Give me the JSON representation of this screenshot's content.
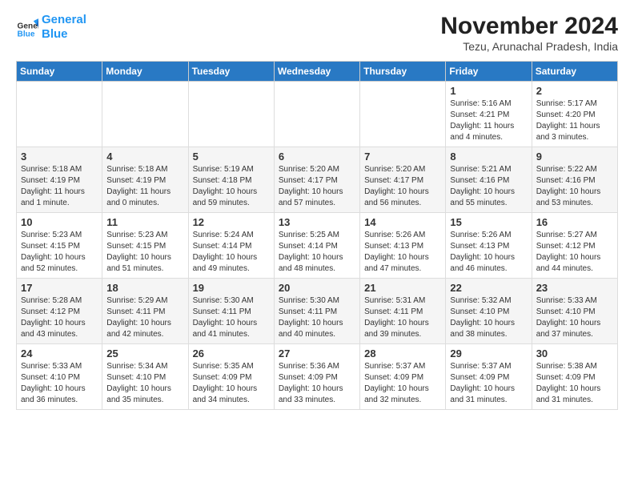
{
  "header": {
    "logo_line1": "General",
    "logo_line2": "Blue",
    "month_title": "November 2024",
    "subtitle": "Tezu, Arunachal Pradesh, India"
  },
  "weekdays": [
    "Sunday",
    "Monday",
    "Tuesday",
    "Wednesday",
    "Thursday",
    "Friday",
    "Saturday"
  ],
  "weeks": [
    [
      {
        "day": "",
        "info": ""
      },
      {
        "day": "",
        "info": ""
      },
      {
        "day": "",
        "info": ""
      },
      {
        "day": "",
        "info": ""
      },
      {
        "day": "",
        "info": ""
      },
      {
        "day": "1",
        "info": "Sunrise: 5:16 AM\nSunset: 4:21 PM\nDaylight: 11 hours\nand 4 minutes."
      },
      {
        "day": "2",
        "info": "Sunrise: 5:17 AM\nSunset: 4:20 PM\nDaylight: 11 hours\nand 3 minutes."
      }
    ],
    [
      {
        "day": "3",
        "info": "Sunrise: 5:18 AM\nSunset: 4:19 PM\nDaylight: 11 hours\nand 1 minute."
      },
      {
        "day": "4",
        "info": "Sunrise: 5:18 AM\nSunset: 4:19 PM\nDaylight: 11 hours\nand 0 minutes."
      },
      {
        "day": "5",
        "info": "Sunrise: 5:19 AM\nSunset: 4:18 PM\nDaylight: 10 hours\nand 59 minutes."
      },
      {
        "day": "6",
        "info": "Sunrise: 5:20 AM\nSunset: 4:17 PM\nDaylight: 10 hours\nand 57 minutes."
      },
      {
        "day": "7",
        "info": "Sunrise: 5:20 AM\nSunset: 4:17 PM\nDaylight: 10 hours\nand 56 minutes."
      },
      {
        "day": "8",
        "info": "Sunrise: 5:21 AM\nSunset: 4:16 PM\nDaylight: 10 hours\nand 55 minutes."
      },
      {
        "day": "9",
        "info": "Sunrise: 5:22 AM\nSunset: 4:16 PM\nDaylight: 10 hours\nand 53 minutes."
      }
    ],
    [
      {
        "day": "10",
        "info": "Sunrise: 5:23 AM\nSunset: 4:15 PM\nDaylight: 10 hours\nand 52 minutes."
      },
      {
        "day": "11",
        "info": "Sunrise: 5:23 AM\nSunset: 4:15 PM\nDaylight: 10 hours\nand 51 minutes."
      },
      {
        "day": "12",
        "info": "Sunrise: 5:24 AM\nSunset: 4:14 PM\nDaylight: 10 hours\nand 49 minutes."
      },
      {
        "day": "13",
        "info": "Sunrise: 5:25 AM\nSunset: 4:14 PM\nDaylight: 10 hours\nand 48 minutes."
      },
      {
        "day": "14",
        "info": "Sunrise: 5:26 AM\nSunset: 4:13 PM\nDaylight: 10 hours\nand 47 minutes."
      },
      {
        "day": "15",
        "info": "Sunrise: 5:26 AM\nSunset: 4:13 PM\nDaylight: 10 hours\nand 46 minutes."
      },
      {
        "day": "16",
        "info": "Sunrise: 5:27 AM\nSunset: 4:12 PM\nDaylight: 10 hours\nand 44 minutes."
      }
    ],
    [
      {
        "day": "17",
        "info": "Sunrise: 5:28 AM\nSunset: 4:12 PM\nDaylight: 10 hours\nand 43 minutes."
      },
      {
        "day": "18",
        "info": "Sunrise: 5:29 AM\nSunset: 4:11 PM\nDaylight: 10 hours\nand 42 minutes."
      },
      {
        "day": "19",
        "info": "Sunrise: 5:30 AM\nSunset: 4:11 PM\nDaylight: 10 hours\nand 41 minutes."
      },
      {
        "day": "20",
        "info": "Sunrise: 5:30 AM\nSunset: 4:11 PM\nDaylight: 10 hours\nand 40 minutes."
      },
      {
        "day": "21",
        "info": "Sunrise: 5:31 AM\nSunset: 4:11 PM\nDaylight: 10 hours\nand 39 minutes."
      },
      {
        "day": "22",
        "info": "Sunrise: 5:32 AM\nSunset: 4:10 PM\nDaylight: 10 hours\nand 38 minutes."
      },
      {
        "day": "23",
        "info": "Sunrise: 5:33 AM\nSunset: 4:10 PM\nDaylight: 10 hours\nand 37 minutes."
      }
    ],
    [
      {
        "day": "24",
        "info": "Sunrise: 5:33 AM\nSunset: 4:10 PM\nDaylight: 10 hours\nand 36 minutes."
      },
      {
        "day": "25",
        "info": "Sunrise: 5:34 AM\nSunset: 4:10 PM\nDaylight: 10 hours\nand 35 minutes."
      },
      {
        "day": "26",
        "info": "Sunrise: 5:35 AM\nSunset: 4:09 PM\nDaylight: 10 hours\nand 34 minutes."
      },
      {
        "day": "27",
        "info": "Sunrise: 5:36 AM\nSunset: 4:09 PM\nDaylight: 10 hours\nand 33 minutes."
      },
      {
        "day": "28",
        "info": "Sunrise: 5:37 AM\nSunset: 4:09 PM\nDaylight: 10 hours\nand 32 minutes."
      },
      {
        "day": "29",
        "info": "Sunrise: 5:37 AM\nSunset: 4:09 PM\nDaylight: 10 hours\nand 31 minutes."
      },
      {
        "day": "30",
        "info": "Sunrise: 5:38 AM\nSunset: 4:09 PM\nDaylight: 10 hours\nand 31 minutes."
      }
    ]
  ]
}
